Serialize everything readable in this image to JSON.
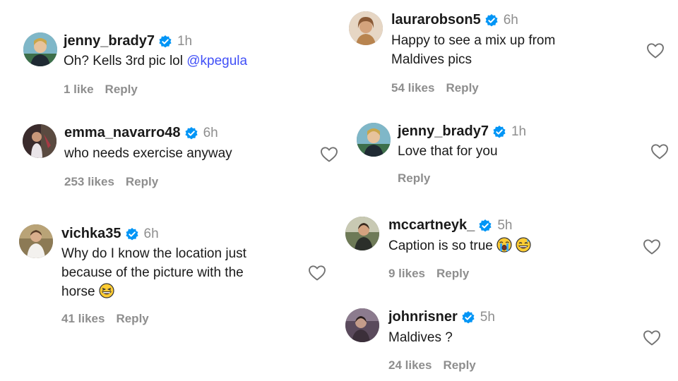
{
  "left": {
    "c1": {
      "user": "jenny_brady7",
      "time": "1h",
      "text": "Oh? Kells 3rd pic lol ",
      "mention": "@kpegula",
      "likes": "1 like",
      "reply": "Reply"
    },
    "c2": {
      "user": "emma_navarro48",
      "time": "6h",
      "text": "who needs exercise anyway",
      "likes": "253 likes",
      "reply": "Reply"
    },
    "c3": {
      "user": "vichka35",
      "time": "6h",
      "line1": "Why do I know the location just",
      "line2": "because of the picture with the",
      "line3": "horse",
      "emoji": "grinning-squinting-face",
      "likes": "41 likes",
      "reply": "Reply"
    }
  },
  "right": {
    "c1": {
      "user": "laurarobson5",
      "time": "6h",
      "line1": "Happy to see a mix up from",
      "line2": "Maldives pics",
      "likes": "54 likes",
      "reply": "Reply"
    },
    "c2": {
      "user": "jenny_brady7",
      "time": "1h",
      "text": "Love that for you",
      "reply": "Reply"
    },
    "c3": {
      "user": "mccartneyk_",
      "time": "5h",
      "text": "Caption is so true ",
      "emojis": [
        "loudly-crying-face",
        "grinning-sweat-face"
      ],
      "likes": "9 likes",
      "reply": "Reply"
    },
    "c4": {
      "user": "johnrisner",
      "time": "5h",
      "text": "Maldives ?",
      "likes": "24 likes",
      "reply": "Reply"
    }
  },
  "colors": {
    "verified": "#0095f6",
    "mention": "#4150f7",
    "muted": "#8e8e8e"
  }
}
